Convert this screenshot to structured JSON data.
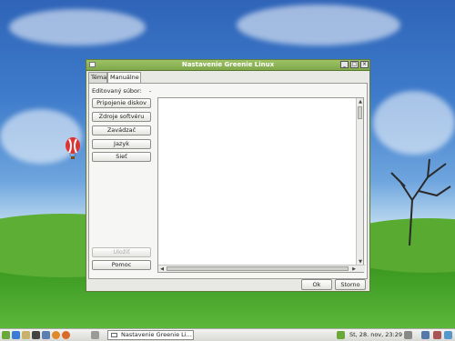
{
  "window": {
    "title": "Nastavenie Greenie Linux",
    "tabs": [
      {
        "label": "Téma"
      },
      {
        "label": "Manuálne"
      }
    ],
    "edited_file_label": "Editovaný súbor:",
    "edited_file_value": "-",
    "side_buttons": [
      {
        "label": "Pripojenie diskov"
      },
      {
        "label": "Zdroje softvéru"
      },
      {
        "label": "Zavádzač"
      },
      {
        "label": "Jazyk"
      },
      {
        "label": "Sieť"
      }
    ],
    "save_label": "Uložiť",
    "help_label": "Pomoc",
    "ok_label": "Ok",
    "cancel_label": "Storno"
  },
  "taskbar": {
    "task_label": "Nastavenie Greenie Li...",
    "clock": "St, 28. nov, 23:29"
  }
}
